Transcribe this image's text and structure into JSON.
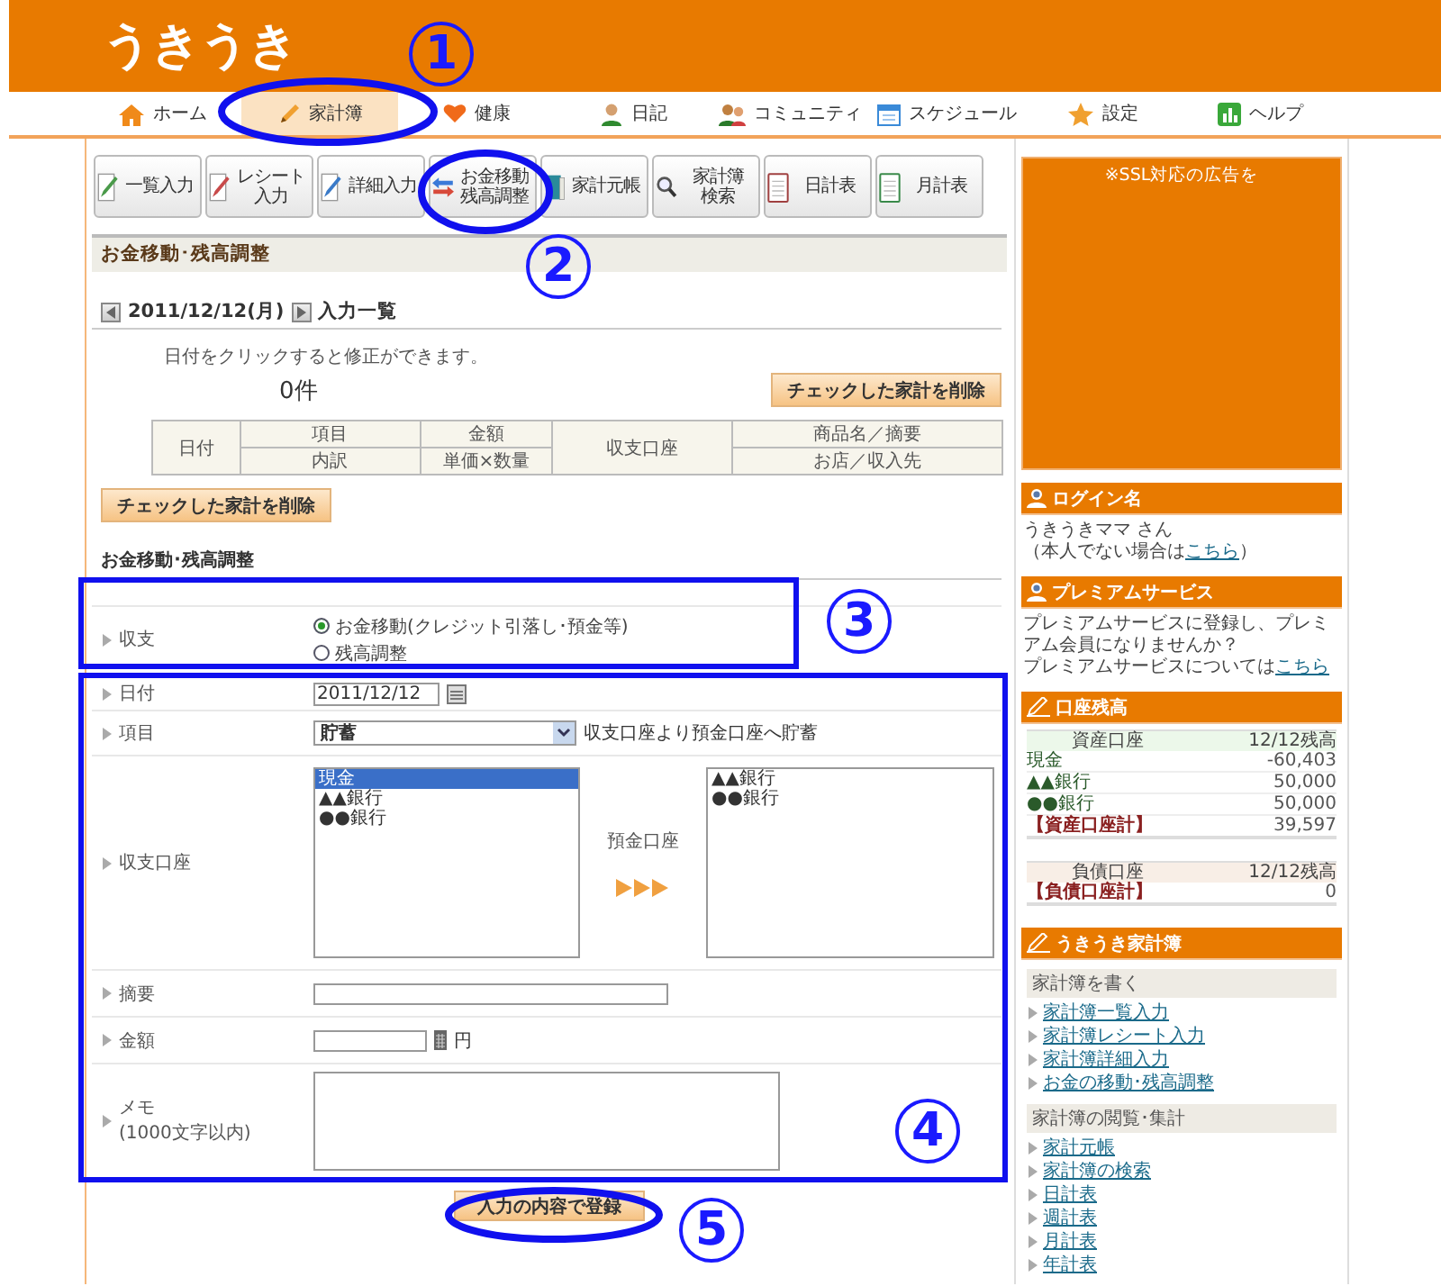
{
  "logo": "うきうき",
  "nav": [
    {
      "label": "ホーム",
      "selected": false
    },
    {
      "label": "家計簿",
      "selected": true
    },
    {
      "label": "健康",
      "selected": false
    },
    {
      "label": "日記",
      "selected": false
    },
    {
      "label": "コミュニティ",
      "selected": false
    },
    {
      "label": "スケジュール",
      "selected": false
    },
    {
      "label": "設定",
      "selected": false
    },
    {
      "label": "ヘルプ",
      "selected": false
    }
  ],
  "toolbar": [
    {
      "lines": [
        "一覧入力"
      ]
    },
    {
      "lines": [
        "レシート入力"
      ]
    },
    {
      "lines": [
        "詳細入力"
      ]
    },
    {
      "lines": [
        "お金移動",
        "残高調整"
      ]
    },
    {
      "lines": [
        "家計元帳"
      ]
    },
    {
      "lines": [
        "家計簿",
        "検索"
      ]
    },
    {
      "lines": [
        "日計表"
      ]
    },
    {
      "lines": [
        "月計表"
      ]
    }
  ],
  "page_title": "お金移動･残高調整",
  "entry_list": {
    "date": "2011/12/12(月)",
    "title": "入力一覧",
    "hint": "日付をクリックすると修正ができます。",
    "count": "0件",
    "delete_button_top": "チェックした家計を削除",
    "columns": [
      {
        "top": "日付"
      },
      {
        "top": "項目",
        "bottom": "内訳"
      },
      {
        "top": "金額",
        "bottom": "単価×数量"
      },
      {
        "top": "収支口座"
      },
      {
        "top": "商品名／摘要",
        "bottom": "お店／収入先"
      }
    ],
    "delete_button_bottom": "チェックした家計を削除"
  },
  "form": {
    "heading": "お金移動･残高調整",
    "type_label": "収支",
    "type_options": [
      {
        "label": "お金移動(クレジット引落し･預金等)",
        "selected": true
      },
      {
        "label": "残高調整",
        "selected": false
      }
    ],
    "date_label": "日付",
    "date_value": "2011/12/12",
    "category_label": "項目",
    "category_value": "貯蓄",
    "category_note": "収支口座より預金口座へ貯蓄",
    "account_label": "収支口座",
    "from_accounts": [
      {
        "label": "現金",
        "selected": true
      },
      {
        "label": "▲▲銀行",
        "selected": false
      },
      {
        "label": "●●銀行",
        "selected": false
      }
    ],
    "to_label": "預金口座",
    "to_accounts": [
      {
        "label": "▲▲銀行",
        "selected": false
      },
      {
        "label": "●●銀行",
        "selected": false
      }
    ],
    "summary_label": "摘要",
    "amount_label": "金額",
    "amount_unit": "円",
    "memo_label": "メモ",
    "memo_hint": "(1000文字以内)",
    "submit": "入力の内容で登録"
  },
  "sidebar": {
    "ad_text": "※SSL対応の広告を",
    "login": {
      "title": "ログイン名",
      "name": "うきうきママ さん",
      "note_before": "（本人でない場合は",
      "link": "こちら",
      "note_after": "）"
    },
    "premium": {
      "title": "プレミアムサービス",
      "text": "プレミアムサービスに登録し、プレミアム会員になりませんか？",
      "note": "プレミアムサービスについては",
      "link": "こちら"
    },
    "balance": {
      "title": "口座残高",
      "assets": {
        "header": [
          "資産口座",
          "12/12残高"
        ],
        "rows": [
          {
            "name": "現金",
            "amount": "-60,403"
          },
          {
            "name": "▲▲銀行",
            "amount": "50,000"
          },
          {
            "name": "●●銀行",
            "amount": "50,000"
          }
        ],
        "total": {
          "name": "【資産口座計】",
          "amount": "39,597"
        }
      },
      "liabilities": {
        "header": [
          "負債口座",
          "12/12残高"
        ],
        "total": {
          "name": "【負債口座計】",
          "amount": "0"
        }
      }
    },
    "kakeibo": {
      "title": "うきうき家計簿",
      "groups": [
        {
          "title": "家計簿を書く",
          "links": [
            "家計簿一覧入力",
            "家計簿レシート入力",
            "家計簿詳細入力",
            "お金の移動･残高調整"
          ]
        },
        {
          "title": "家計簿の閲覧･集計",
          "links": [
            "家計元帳",
            "家計簿の検索",
            "日計表",
            "週計表",
            "月計表",
            "年計表"
          ]
        }
      ]
    }
  },
  "annotations": {
    "markers": [
      {
        "number": "1"
      },
      {
        "number": "2"
      },
      {
        "number": "3"
      },
      {
        "number": "4"
      },
      {
        "number": "5"
      }
    ],
    "highlights": [
      {
        "kind": "ellipse"
      },
      {
        "kind": "ellipse"
      },
      {
        "kind": "frame"
      },
      {
        "kind": "frame"
      },
      {
        "kind": "ellipse"
      }
    ]
  }
}
